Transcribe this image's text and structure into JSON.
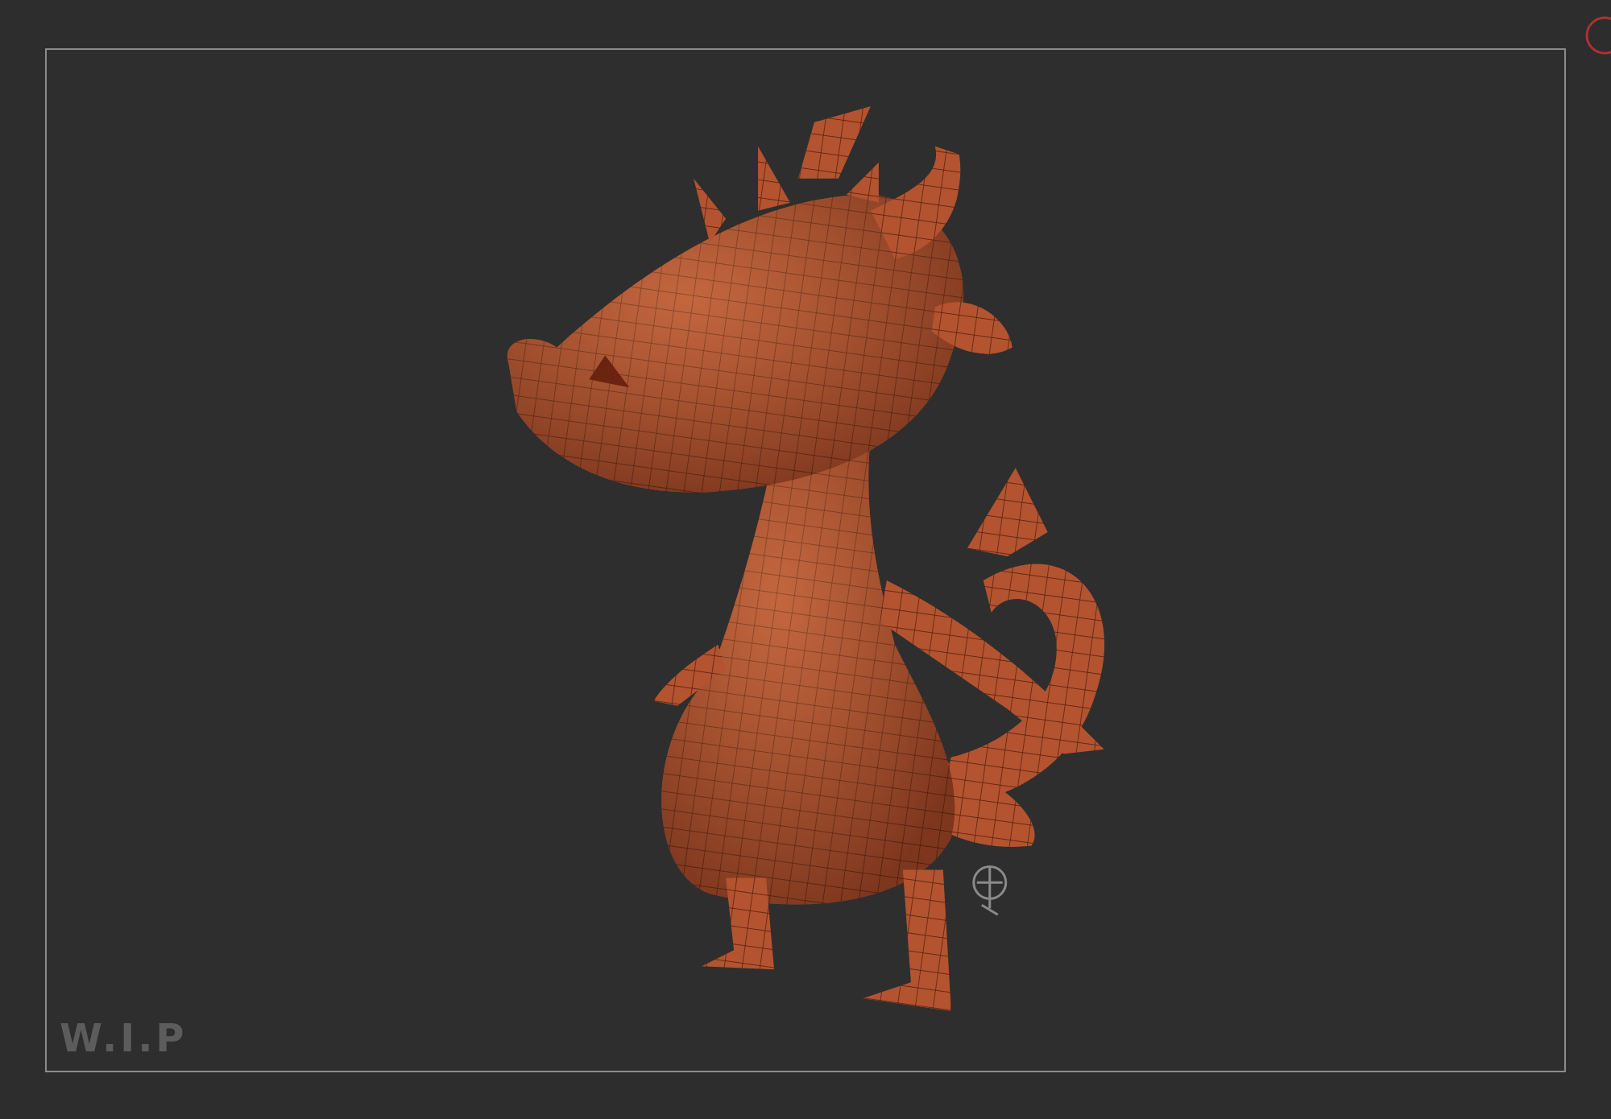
{
  "viewport": {
    "label": "W.I.P"
  }
}
